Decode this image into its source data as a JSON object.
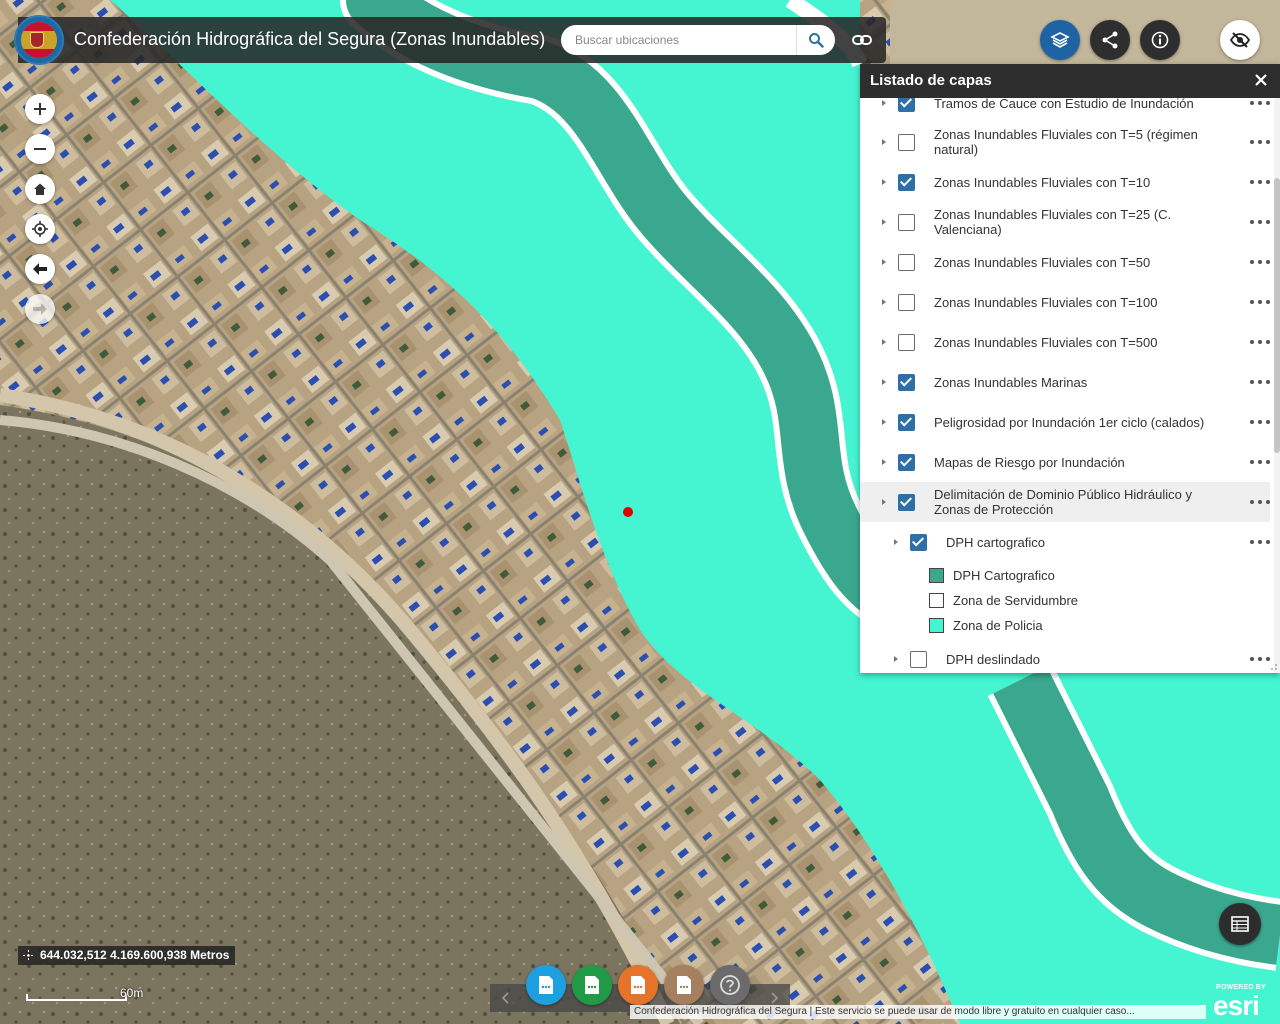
{
  "header": {
    "title": "Confederación Hidrográfica del Segura (Zonas Inundables)",
    "search_placeholder": "Buscar ubicaciones"
  },
  "toolbar_right": {
    "icons": [
      "layers-icon",
      "share-icon",
      "info-icon",
      "visibility-off-icon"
    ]
  },
  "map_controls": {
    "icons": [
      "zoom-in-icon",
      "zoom-out-icon",
      "home-icon",
      "locate-icon",
      "back-icon",
      "forward-icon"
    ]
  },
  "layer_panel": {
    "title": "Listado de capas",
    "layers": [
      {
        "label": "Tramos de Cauce con Estudio de Inundación",
        "checked": true
      },
      {
        "label": "Zonas Inundables Fluviales con T=5 (régimen natural)",
        "checked": false
      },
      {
        "label": "Zonas Inundables Fluviales con T=10",
        "checked": true
      },
      {
        "label": "Zonas Inundables Fluviales con T=25 (C. Valenciana)",
        "checked": false
      },
      {
        "label": "Zonas Inundables Fluviales con T=50",
        "checked": false
      },
      {
        "label": "Zonas Inundables Fluviales con T=100",
        "checked": false
      },
      {
        "label": "Zonas Inundables Fluviales con T=500",
        "checked": false
      },
      {
        "label": "Zonas Inundables Marinas",
        "checked": true
      },
      {
        "label": "Peligrosidad por Inundación 1er ciclo (calados)",
        "checked": true
      },
      {
        "label": "Mapas de Riesgo por Inundación",
        "checked": true
      },
      {
        "label": "Delimitación de Dominio Público Hidráulico y Zonas de Protección",
        "checked": true
      },
      {
        "label": "DPH cartografico",
        "checked": true
      },
      {
        "label": "DPH deslindado",
        "checked": false
      }
    ],
    "legend": [
      {
        "label": "DPH Cartografico",
        "color": "#3aa88f"
      },
      {
        "label": "Zona de Servidumbre",
        "color": "#ffffff"
      },
      {
        "label": "Zona de Policia",
        "color": "#45f5d2"
      }
    ]
  },
  "status": {
    "coordinates": "644.032,512 4.169.600,938 Metros",
    "scale_label": "60m"
  },
  "attribution": "Confederación Hidrográfica del Segura | Este servicio se puede usar de modo libre y gratuito en cualquier caso...",
  "esri": {
    "powered_by": "POWERED BY",
    "brand": "esri"
  },
  "colors": {
    "zona_policia": "#45f5d2",
    "dph_cartografico": "#3aa88f",
    "header_bg": "#282828",
    "accent_blue": "#2f6fa8"
  }
}
